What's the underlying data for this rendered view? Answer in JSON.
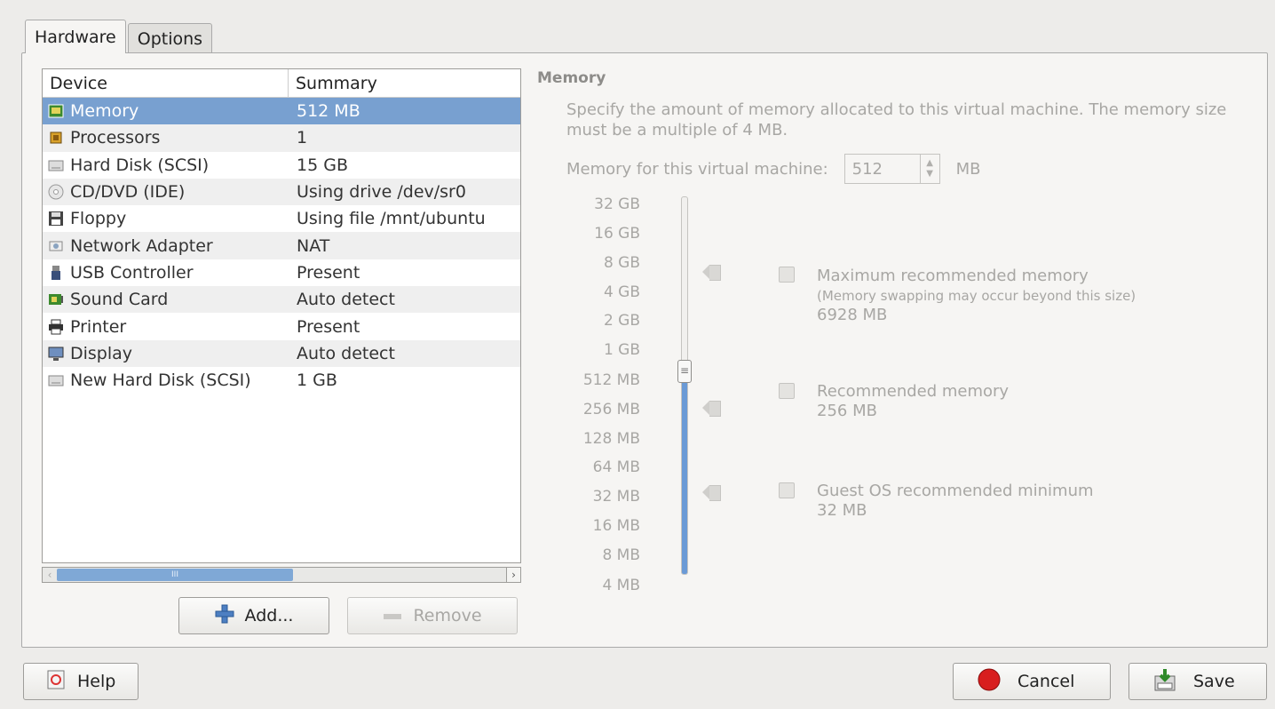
{
  "tabs": [
    {
      "label": "Hardware",
      "active": true
    },
    {
      "label": "Options",
      "active": false
    }
  ],
  "devices": {
    "headers": {
      "device": "Device",
      "summary": "Summary"
    },
    "rows": [
      {
        "icon": "memory-icon",
        "device": "Memory",
        "summary": "512 MB",
        "selected": true
      },
      {
        "icon": "processor-icon",
        "device": "Processors",
        "summary": "1"
      },
      {
        "icon": "hard-disk-icon",
        "device": "Hard Disk (SCSI)",
        "summary": "15 GB"
      },
      {
        "icon": "cd-dvd-icon",
        "device": "CD/DVD (IDE)",
        "summary": "Using drive /dev/sr0"
      },
      {
        "icon": "floppy-icon",
        "device": "Floppy",
        "summary": "Using file /mnt/ubuntu"
      },
      {
        "icon": "network-adapter-icon",
        "device": "Network Adapter",
        "summary": "NAT"
      },
      {
        "icon": "usb-icon",
        "device": "USB Controller",
        "summary": "Present"
      },
      {
        "icon": "sound-card-icon",
        "device": "Sound Card",
        "summary": "Auto detect"
      },
      {
        "icon": "printer-icon",
        "device": "Printer",
        "summary": "Present"
      },
      {
        "icon": "display-icon",
        "device": "Display",
        "summary": "Auto detect"
      },
      {
        "icon": "hard-disk-icon",
        "device": "New Hard Disk (SCSI)",
        "summary": "1 GB"
      }
    ],
    "scroll_thumb_label": "III"
  },
  "buttons": {
    "add": "Add...",
    "remove": "Remove",
    "help": "Help",
    "cancel": "Cancel",
    "save": "Save"
  },
  "memory": {
    "title": "Memory",
    "description": "Specify the amount of memory allocated to this virtual machine. The memory size must be a multiple of 4 MB.",
    "field_label": "Memory for this virtual machine:",
    "field_value": "512",
    "unit": "MB",
    "scale": [
      "32 GB",
      "16 GB",
      "8 GB",
      "4 GB",
      "2 GB",
      "1 GB",
      "512 MB",
      "256 MB",
      "128 MB",
      "64 MB",
      "32 MB",
      "16 MB",
      "8 MB",
      "4 MB"
    ],
    "slider_value": "512 MB",
    "markers": [
      {
        "label": "Maximum recommended memory",
        "note": "(Memory swapping may occur beyond this size)",
        "value": "6928 MB"
      },
      {
        "label": "Recommended memory",
        "value": "256 MB"
      },
      {
        "label": "Guest OS recommended minimum",
        "value": "32 MB"
      }
    ]
  },
  "colors": {
    "selection": "#78a0d0",
    "slider_fill": "#6a9ad6",
    "cancel_red": "#d81e1e"
  }
}
